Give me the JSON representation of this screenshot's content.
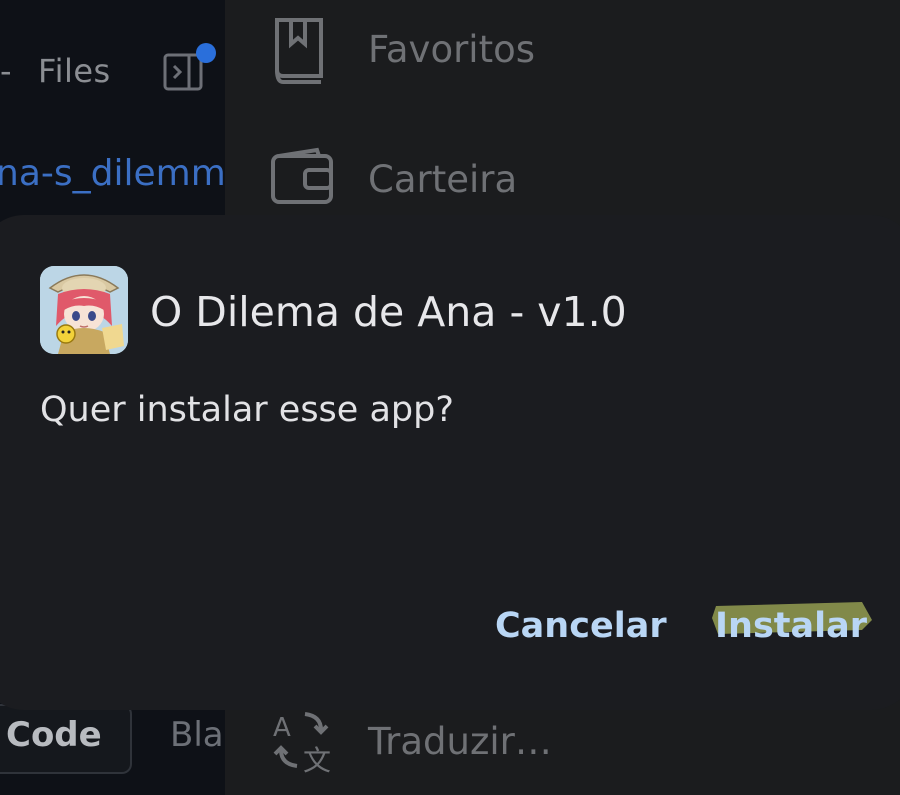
{
  "background_app": {
    "header_files_label": "Files",
    "repo_name": "na-s_dilemma",
    "tabs": {
      "code": "Code",
      "blame": "Bla"
    }
  },
  "menu": {
    "items": [
      {
        "label": "Favoritos",
        "icon": "bookmark-icon"
      },
      {
        "label": "Carteira",
        "icon": "wallet-icon"
      },
      {
        "label": "Traduzir…",
        "icon": "translate-icon"
      }
    ]
  },
  "dialog": {
    "title": "O Dilema de Ana - v1.0",
    "message": "Quer instalar esse app?",
    "cancel_label": "Cancelar",
    "install_label": "Instalar",
    "app_icon": "app-character-icon"
  },
  "colors": {
    "dialog_bg": "#1b1c20",
    "button_text": "#b9d6f5",
    "highlight": "#d6e36b",
    "link": "#3b6fc4"
  }
}
